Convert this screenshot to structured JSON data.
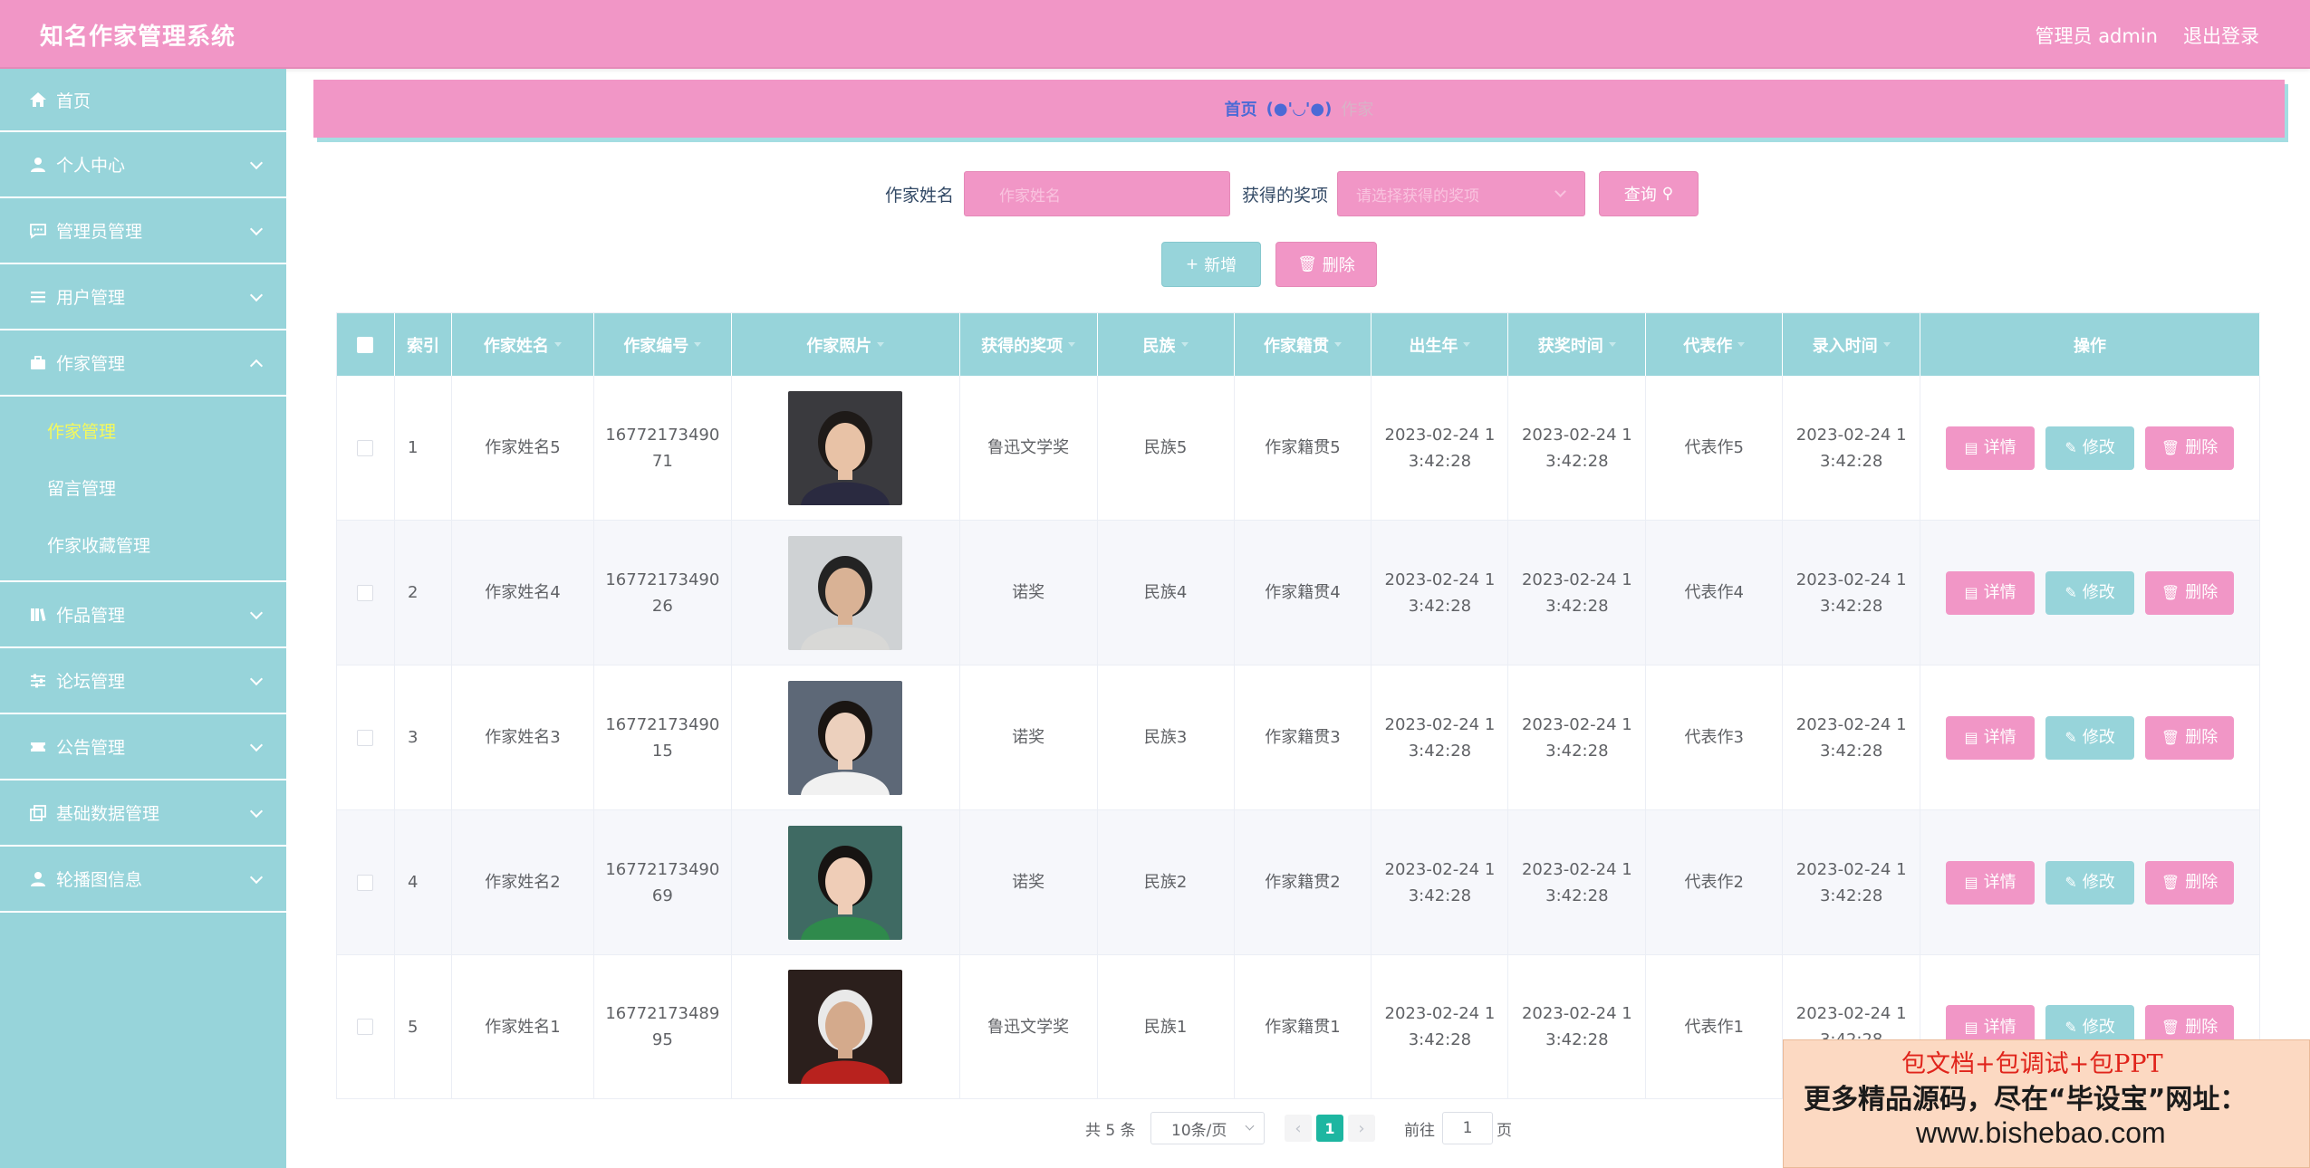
{
  "app": {
    "title": "知名作家管理系统",
    "user": "管理员 admin",
    "logout": "退出登录"
  },
  "sidebar": {
    "home": "首页",
    "items": [
      {
        "label": "个人中心",
        "icon": "user-icon"
      },
      {
        "label": "管理员管理",
        "icon": "chat-icon"
      },
      {
        "label": "用户管理",
        "icon": "list-icon"
      },
      {
        "label": "作家管理",
        "icon": "briefcase-icon",
        "expanded": true
      },
      {
        "label": "作品管理",
        "icon": "book-icon"
      },
      {
        "label": "论坛管理",
        "icon": "sliders-icon"
      },
      {
        "label": "公告管理",
        "icon": "ticket-icon"
      },
      {
        "label": "基础数据管理",
        "icon": "copy-icon"
      },
      {
        "label": "轮播图信息",
        "icon": "user-icon"
      }
    ],
    "sub_items": [
      "作家管理",
      "留言管理",
      "作家收藏管理"
    ],
    "active_sub": "作家管理"
  },
  "breadcrumb": {
    "home": "首页",
    "sep": "(●'◡'●)",
    "current": "作家"
  },
  "search": {
    "name_label": "作家姓名",
    "name_placeholder": "作家姓名",
    "award_label": "获得的奖项",
    "award_placeholder": "请选择获得的奖项",
    "query_button": "查询"
  },
  "toolbar": {
    "add_button": "新增",
    "delete_button": "删除"
  },
  "table": {
    "headers": [
      "索引",
      "作家姓名",
      "作家编号",
      "作家照片",
      "获得的奖项",
      "民族",
      "作家籍贯",
      "出生年",
      "获奖时间",
      "代表作",
      "录入时间",
      "操作"
    ],
    "actions": {
      "detail": "详情",
      "edit": "修改",
      "delete": "删除"
    },
    "rows": [
      {
        "index": "1",
        "name": "作家姓名5",
        "code": "1677217349071",
        "award": "鲁迅文学奖",
        "ethnic": "民族5",
        "origin": "作家籍贯5",
        "birth": "2023-02-24 13:42:28",
        "award_time": "2023-02-24 13:42:28",
        "work": "代表作5",
        "entry_time": "2023-02-24 13:42:28"
      },
      {
        "index": "2",
        "name": "作家姓名4",
        "code": "1677217349026",
        "award": "诺奖",
        "ethnic": "民族4",
        "origin": "作家籍贯4",
        "birth": "2023-02-24 13:42:28",
        "award_time": "2023-02-24 13:42:28",
        "work": "代表作4",
        "entry_time": "2023-02-24 13:42:28"
      },
      {
        "index": "3",
        "name": "作家姓名3",
        "code": "1677217349015",
        "award": "诺奖",
        "ethnic": "民族3",
        "origin": "作家籍贯3",
        "birth": "2023-02-24 13:42:28",
        "award_time": "2023-02-24 13:42:28",
        "work": "代表作3",
        "entry_time": "2023-02-24 13:42:28"
      },
      {
        "index": "4",
        "name": "作家姓名2",
        "code": "1677217349069",
        "award": "诺奖",
        "ethnic": "民族2",
        "origin": "作家籍贯2",
        "birth": "2023-02-24 13:42:28",
        "award_time": "2023-02-24 13:42:28",
        "work": "代表作2",
        "entry_time": "2023-02-24 13:42:28"
      },
      {
        "index": "5",
        "name": "作家姓名1",
        "code": "1677217348995",
        "award": "鲁迅文学奖",
        "ethnic": "民族1",
        "origin": "作家籍贯1",
        "birth": "2023-02-24 13:42:28",
        "award_time": "2023-02-24 13:42:28",
        "work": "代表作1",
        "entry_time": "2023-02-24 13:42:28"
      }
    ]
  },
  "pagination": {
    "total": "共 5 条",
    "page_size": "10条/页",
    "current": "1",
    "goto": "前往",
    "goto_value": "1",
    "page_unit": "页"
  },
  "watermark": {
    "line1": "包文档+包调试+包PPT",
    "line2": "更多精品源码，尽在“毕设宝”网址：",
    "line3": "www.bishebao.com"
  },
  "colors": {
    "pink": "#f196c6",
    "teal": "#97d4da",
    "active_sub": "#f6f95a",
    "page_active": "#1db6a1"
  }
}
